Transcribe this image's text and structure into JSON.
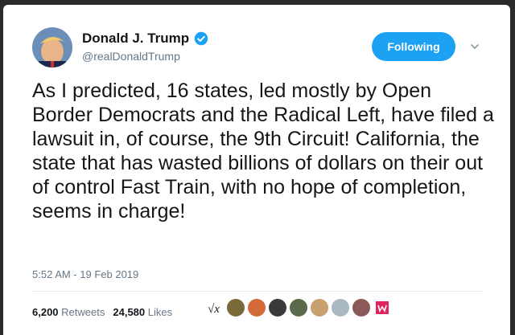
{
  "user": {
    "name": "Donald J. Trump",
    "handle": "@realDonaldTrump"
  },
  "follow_button": {
    "label": "Following"
  },
  "tweet": {
    "text": "As I predicted, 16 states, led mostly by Open Border Democrats and the Radical Left, have filed a lawsuit in, of course, the 9th Circuit! California, the state that has wasted billions of dollars on their out of control Fast Train, with no hope of completion, seems in charge!",
    "timestamp": "5:52 AM - 19 Feb 2019"
  },
  "stats": {
    "retweets_count": "6,200",
    "retweets_label": "Retweets",
    "likes_count": "24,580",
    "likes_label": "Likes"
  },
  "colors": {
    "accent": "#1da1f2",
    "text": "#14171a",
    "secondary": "#657786"
  },
  "icons": [
    "verified-badge-icon",
    "chevron-down-icon"
  ]
}
